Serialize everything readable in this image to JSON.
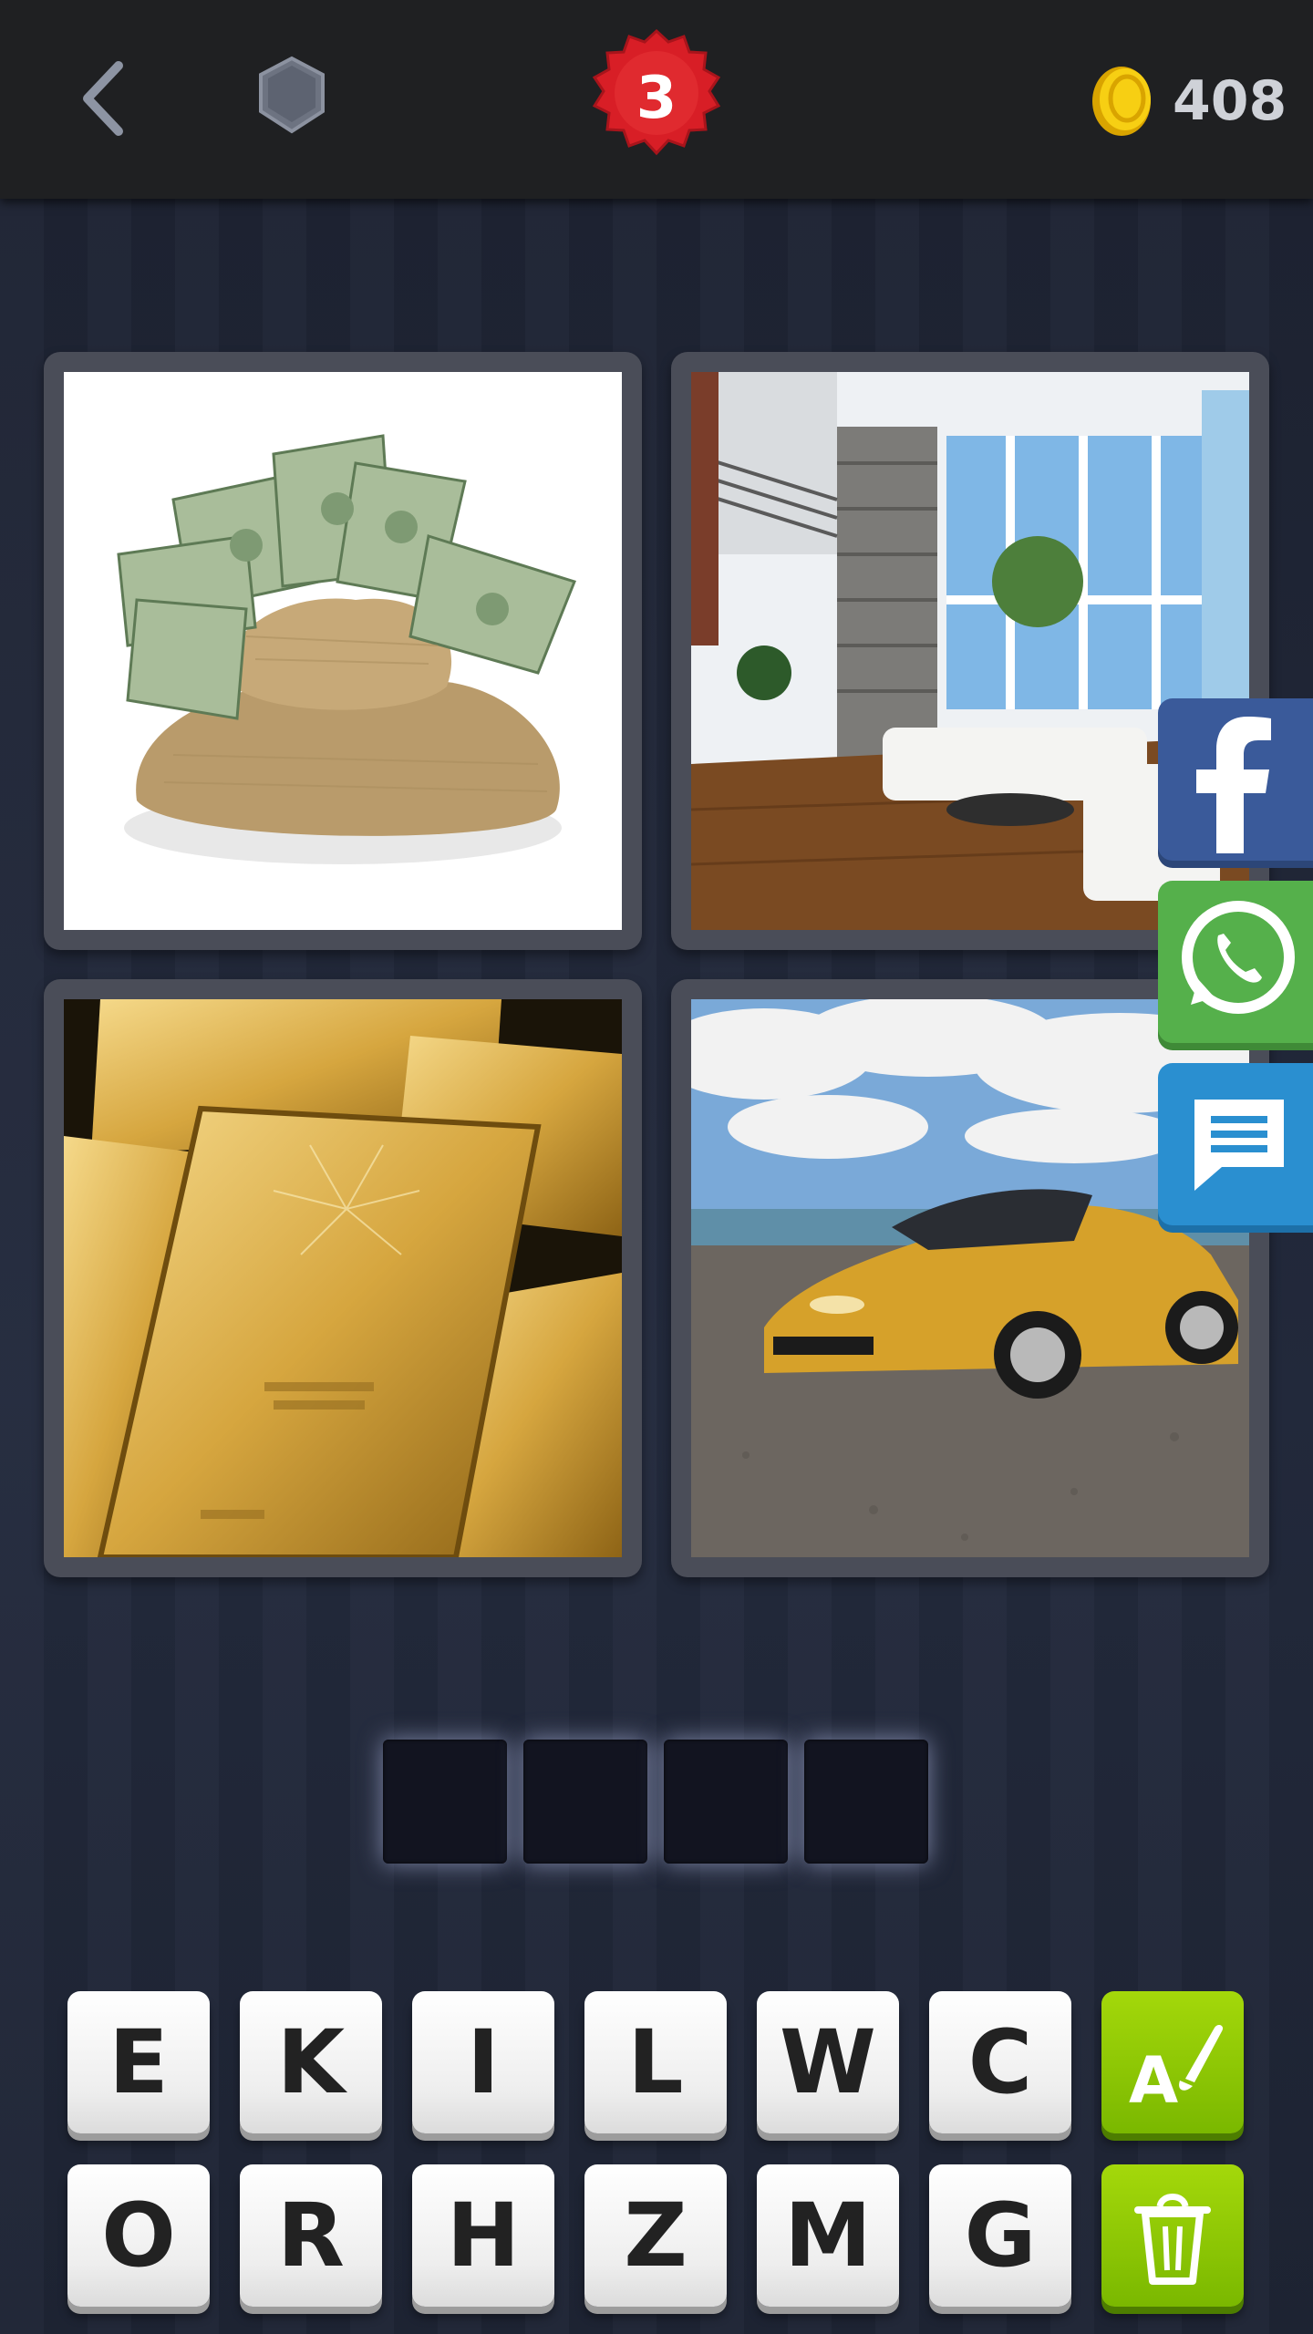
{
  "header": {
    "back_icon": "chevron-left-icon",
    "hint_icon": "shield-icon",
    "level": "3",
    "coin_icon": "coin-icon",
    "coins": "408"
  },
  "images": [
    {
      "name": "money-bag-image",
      "description_icon": "money-bag"
    },
    {
      "name": "luxury-house-image",
      "description_icon": "house-interior"
    },
    {
      "name": "gold-bars-image",
      "description_icon": "gold-bars"
    },
    {
      "name": "sports-car-image",
      "description_icon": "sports-car"
    }
  ],
  "share": {
    "facebook_icon": "facebook-icon",
    "whatsapp_icon": "whatsapp-icon",
    "message_icon": "message-icon"
  },
  "answer": {
    "slots": [
      "",
      "",
      "",
      ""
    ]
  },
  "keyboard": {
    "row1": [
      "E",
      "K",
      "I",
      "L",
      "W",
      "C"
    ],
    "row2": [
      "O",
      "R",
      "H",
      "Z",
      "M",
      "G"
    ],
    "reveal_icon": "reveal-letter-icon",
    "remove_icon": "trash-icon"
  },
  "colors": {
    "accent_green": "#7ab800",
    "level_red": "#d81e26",
    "coin_gold": "#f2c000"
  }
}
